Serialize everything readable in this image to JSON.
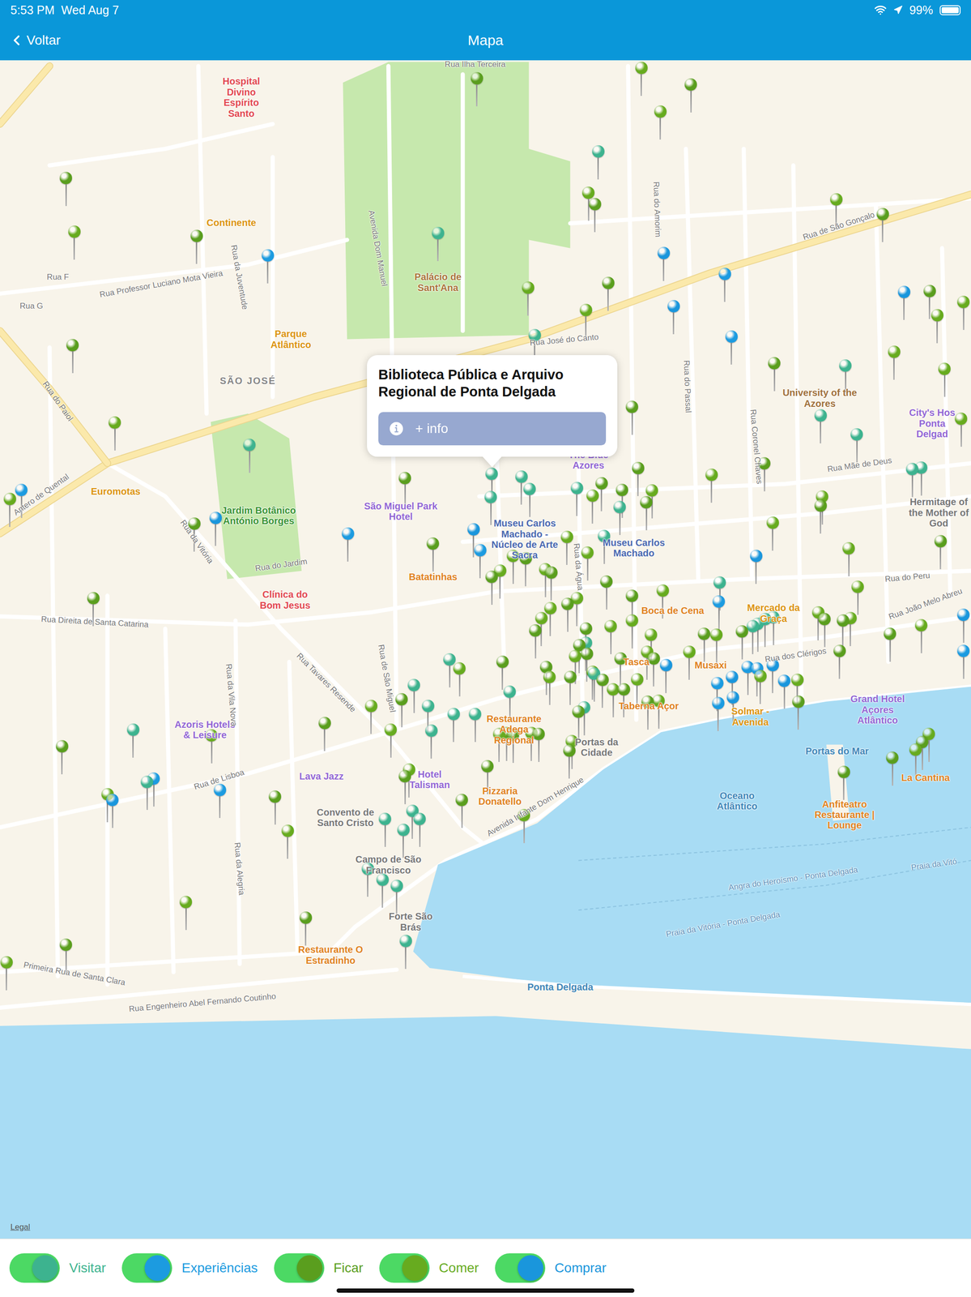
{
  "status_bar": {
    "time": "5:53 PM",
    "date": "Wed Aug 7",
    "battery": "99%",
    "battery_level": 0.99
  },
  "nav": {
    "back": "Voltar",
    "title": "Mapa"
  },
  "callout": {
    "title": "Biblioteca Pública e Arquivo Regional de Ponta Delgada",
    "button": "+ info"
  },
  "map": {
    "legal": "Legal",
    "labels": [
      {
        "text": "Hospital Divino Espírito Santo",
        "kind": "hospital"
      },
      {
        "text": "Continente",
        "kind": "shop"
      },
      {
        "text": "Parque Atlântico",
        "kind": "shop"
      },
      {
        "text": "Palácio de Sant'Ana",
        "kind": "landmark"
      },
      {
        "text": "SÃO JOSÉ",
        "kind": "district"
      },
      {
        "text": "Euromotas",
        "kind": "shop"
      },
      {
        "text": "Jardim Botânico António Borges",
        "kind": "park"
      },
      {
        "text": "Clínica do Bom Jesus",
        "kind": "hospital"
      },
      {
        "text": "São Miguel Park Hotel",
        "kind": "hotel"
      },
      {
        "text": "Batatinhas",
        "kind": "food"
      },
      {
        "text": "Museu Carlos Machado - Núcleo de Arte Sacra",
        "kind": "museum"
      },
      {
        "text": "The Blue Azores",
        "kind": "hotel"
      },
      {
        "text": "Museu Carlos Machado",
        "kind": "museum"
      },
      {
        "text": "University of the Azores",
        "kind": "edu"
      },
      {
        "text": "City's Hos Ponta Delgad",
        "kind": "hotel"
      },
      {
        "text": "Hermitage of the Mother of God",
        "kind": "place"
      },
      {
        "text": "Mercado da Graça",
        "kind": "shop"
      },
      {
        "text": "Boca de Cena",
        "kind": "food"
      },
      {
        "text": "Tasca",
        "kind": "food"
      },
      {
        "text": "Musaxi",
        "kind": "food"
      },
      {
        "text": "Taberna Açor",
        "kind": "food"
      },
      {
        "text": "Solmar - Avenida",
        "kind": "shop"
      },
      {
        "text": "Grand Hotel Açores Atlântico",
        "kind": "hotel"
      },
      {
        "text": "Portas do Mar",
        "kind": "water"
      },
      {
        "text": "La Cantina",
        "kind": "food"
      },
      {
        "text": "Anfiteatro Restaurante | Lounge",
        "kind": "food"
      },
      {
        "text": "Oceano Atlântico",
        "kind": "water"
      },
      {
        "text": "Portas da Cidade",
        "kind": "place"
      },
      {
        "text": "Restaurante Adega Regional",
        "kind": "food"
      },
      {
        "text": "Pizzaria Donatello",
        "kind": "food"
      },
      {
        "text": "Hotel Talisman",
        "kind": "hotel"
      },
      {
        "text": "Lava Jazz",
        "kind": "hotel"
      },
      {
        "text": "Convento de Santo Cristo",
        "kind": "place"
      },
      {
        "text": "Campo de São Francisco",
        "kind": "place"
      },
      {
        "text": "Forte São Brás",
        "kind": "place"
      },
      {
        "text": "Restaurante O Estradinho",
        "kind": "food"
      },
      {
        "text": "Ponta Delgada",
        "kind": "water"
      },
      {
        "text": "Azoris Hotels & Leisure",
        "kind": "hotel"
      },
      {
        "text": "Rua Ilha Terceira",
        "kind": "street"
      },
      {
        "text": "Rua de São Gonçalo",
        "kind": "street"
      },
      {
        "text": "Rua José do Canto",
        "kind": "street"
      },
      {
        "text": "Rua do Paiol",
        "kind": "street"
      },
      {
        "text": "Antero de Quental",
        "kind": "street"
      },
      {
        "text": "Rua da Vitória",
        "kind": "street"
      },
      {
        "text": "Rua Direita de Santa Catarina",
        "kind": "street"
      },
      {
        "text": "Rua Tavares Resende",
        "kind": "street"
      },
      {
        "text": "Rua de Lisboa",
        "kind": "street"
      },
      {
        "text": "Avenida Infante Dom Henrique",
        "kind": "street"
      },
      {
        "text": "Rua Engenheiro Abel Fernando Coutinho",
        "kind": "street"
      },
      {
        "text": "Primeira Rua de Santa Clara",
        "kind": "street"
      },
      {
        "text": "Rua do Peru",
        "kind": "street"
      },
      {
        "text": "Rua Mãe de Deus",
        "kind": "street"
      },
      {
        "text": "Rua dos Clérigos",
        "kind": "street"
      },
      {
        "text": "Rua João Melo Abreu",
        "kind": "street"
      },
      {
        "text": "Rua do Jardim",
        "kind": "street"
      },
      {
        "text": "Avenida Dom Manuel",
        "kind": "street"
      },
      {
        "text": "Rua Professor Luciano Mota Vieira",
        "kind": "street"
      },
      {
        "text": "Rua do Passal",
        "kind": "street"
      },
      {
        "text": "Rua Coronel Chaves",
        "kind": "street"
      },
      {
        "text": "Rua do Amorim",
        "kind": "street"
      },
      {
        "text": "Rua da Vila Nova",
        "kind": "street"
      },
      {
        "text": "Rua da Alegria",
        "kind": "street"
      },
      {
        "text": "Angra do Heroísmo - Ponta Delgada",
        "kind": "route"
      },
      {
        "text": "Praia da Vitória - Ponta Delgada",
        "kind": "route"
      },
      {
        "text": "Praia da Vitó",
        "kind": "route"
      },
      {
        "text": "Rua da Água",
        "kind": "street"
      },
      {
        "text": "Rua de São Miguel",
        "kind": "street"
      },
      {
        "text": "Rua da Juventude",
        "kind": "street"
      },
      {
        "text": "Rua G",
        "kind": "street"
      },
      {
        "text": "Rua F",
        "kind": "street"
      }
    ]
  },
  "filters": [
    {
      "label": "Visitar",
      "on": true,
      "color": "#3db38f"
    },
    {
      "label": "Experiências",
      "on": true,
      "color": "#1c9be0"
    },
    {
      "label": "Ficar",
      "on": true,
      "color": "#5a9e1e"
    },
    {
      "label": "Comer",
      "on": true,
      "color": "#67ab1f"
    },
    {
      "label": "Comprar",
      "on": true,
      "color": "#1a96dc"
    }
  ]
}
